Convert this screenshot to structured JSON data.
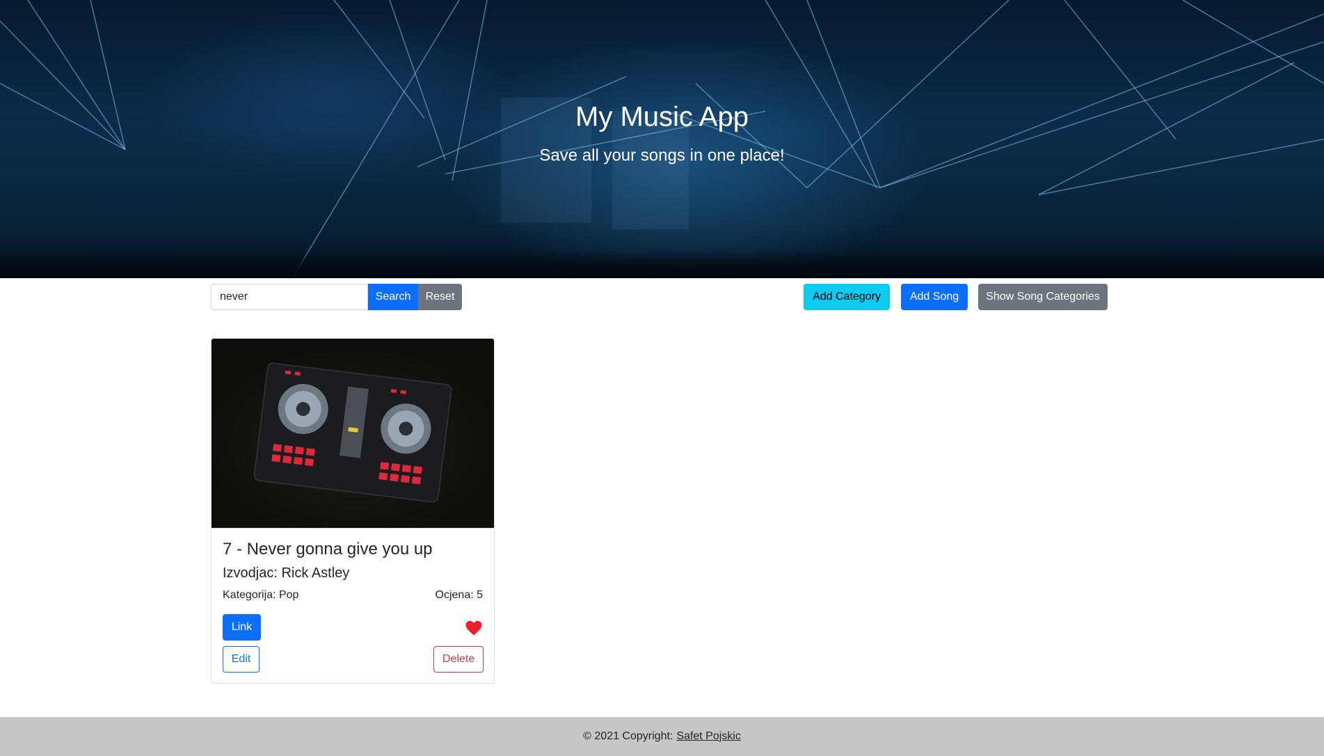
{
  "hero": {
    "title": "My Music App",
    "subtitle": "Save all your songs in one place!"
  },
  "toolbar": {
    "search_value": "never",
    "search_label": "Search",
    "reset_label": "Reset",
    "add_category_label": "Add Category",
    "add_song_label": "Add Song",
    "show_categories_label": "Show Song Categories"
  },
  "songs": [
    {
      "title": "7 - Never gonna give you up",
      "artist": "Izvodjac: Rick Astley",
      "category": "Kategorija: Pop",
      "rating": "Ocjena: 5",
      "link_label": "Link",
      "edit_label": "Edit",
      "delete_label": "Delete",
      "favorite_icon": "heart-icon"
    }
  ],
  "footer": {
    "copyright": "© 2021 Copyright:",
    "author": "Safet Pojskic"
  },
  "colors": {
    "primary": "#0d6efd",
    "secondary": "#6c757d",
    "info": "#0dcaf0",
    "danger": "#dc3545",
    "footer_bg": "#c6c6c6"
  }
}
